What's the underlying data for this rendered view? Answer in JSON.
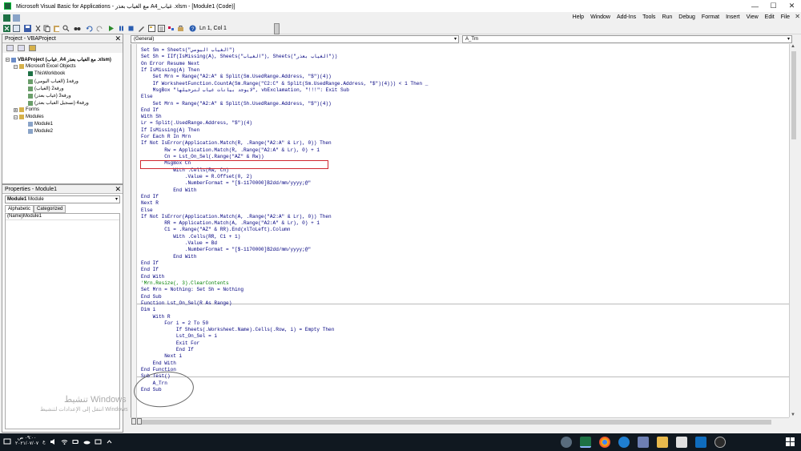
{
  "window": {
    "title": "Microsoft Visual Basic for Applications - مع الغياب بعذر A4_غياب .xlsm - [Module1 (Code)]",
    "controls": [
      "—",
      "☐",
      "✕"
    ]
  },
  "menu": {
    "items": [
      "Help",
      "Window",
      "Add-Ins",
      "Tools",
      "Run",
      "Debug",
      "Format",
      "Insert",
      "View",
      "Edit",
      "File"
    ],
    "close_glyph": "✕"
  },
  "toolbar": {
    "position_label": "Ln 1, Col 1"
  },
  "project_pane": {
    "title": "Project - VBAProject",
    "close_glyph": "✕",
    "tree": [
      {
        "label": "VBAProject (غياب_A4 مع الغياب بعذر .xlsm)",
        "level": 0,
        "bold": true,
        "expander": "−",
        "icon": "project-icon"
      },
      {
        "label": "Microsoft Excel Objects",
        "level": 1,
        "expander": "−",
        "icon": "folder-icon"
      },
      {
        "label": "ThisWorkbook",
        "level": 2,
        "icon": "workbook-icon"
      },
      {
        "label": "ورقة1 (الغياب اليومي)",
        "level": 2,
        "icon": "sheet-icon"
      },
      {
        "label": "ورقة2 (الغياب)",
        "level": 2,
        "icon": "sheet-icon"
      },
      {
        "label": "ورقة3 (غياب بعذر)",
        "level": 2,
        "icon": "sheet-icon"
      },
      {
        "label": "ورقة4 (تسجيل الغياب بعذر)",
        "level": 2,
        "icon": "sheet-icon"
      },
      {
        "label": "Forms",
        "level": 1,
        "expander": "+",
        "icon": "folder-icon"
      },
      {
        "label": "Modules",
        "level": 1,
        "expander": "−",
        "icon": "folder-icon"
      },
      {
        "label": "Module1",
        "level": 2,
        "icon": "module-icon"
      },
      {
        "label": "Module2",
        "level": 2,
        "icon": "module-icon"
      }
    ]
  },
  "properties_pane": {
    "title": "Properties - Module1",
    "close_glyph": "✕",
    "object_name": "Module1",
    "object_type": "Module",
    "tabs": [
      "Alphabetic",
      "Categorized"
    ],
    "rows": [
      {
        "name": "(Name)",
        "value": "Module1"
      }
    ]
  },
  "code_window": {
    "object_combo": "(General)",
    "proc_combo": "A_Trn",
    "lines": [
      {
        "t": "Set Sm = Sheets(\"الغياب اليومي\")",
        "s": "k"
      },
      {
        "t": "Set Sh = IIf(IsMissing(A), Sheets(\"الغياب\"), Sheets(\"الغياب بعذر\"))",
        "s": "k"
      },
      {
        "t": "On Error Resume Next",
        "s": "k"
      },
      {
        "t": "If IsMissing(A) Then",
        "s": "k"
      },
      {
        "t": "    Set Mrn = Range(\"A2:A\" & Split(Sm.UsedRange.Address, \"$\")(4))",
        "s": "k"
      },
      {
        "t": "    If WorksheetFunction.CountA(Sm.Range(\"C2:C\" & Split(Sm.UsedRange.Address, \"$\")(4))) < 1 Then _",
        "s": "k"
      },
      {
        "t": "    MsgBox \"لايوجد بيانات غياب لترحيلها\", vbExclamation, \"!!!\": Exit Sub",
        "s": "k"
      },
      {
        "t": "Else",
        "s": "k"
      },
      {
        "t": "    Set Mrn = Range(\"A2:A\" & Split(Sh.UsedRange.Address, \"$\")(4))",
        "s": "k"
      },
      {
        "t": "End If",
        "s": "k"
      },
      {
        "t": "With Sh",
        "s": "k"
      },
      {
        "t": "Lr = Split(.UsedRange.Address, \"$\")(4)",
        "s": "k"
      },
      {
        "t": "If IsMissing(A) Then",
        "s": "k"
      },
      {
        "t": "For Each R In Mrn",
        "s": "k"
      },
      {
        "t": "If Not IsError(Application.Match(R, .Range(\"A2:A\" & Lr), 0)) Then",
        "s": "k"
      },
      {
        "t": "        Rw = Application.Match(R, .Range(\"A2:A\" & Lr), 0) + 1",
        "s": "k"
      },
      {
        "t": "        Cn = Lst_On_Sel(.Range(\"AZ\" & Rw))",
        "s": "k"
      },
      {
        "t": "        MsgBox Cn",
        "s": "k"
      },
      {
        "t": "           With .Cells(Rw, Cn)",
        "s": "k"
      },
      {
        "t": "               .Value = R.Offset(0, 2)",
        "s": "k"
      },
      {
        "t": "               .NumberFormat = \"[$-1170000]B2dd/mm/yyyy;@\"",
        "s": "k"
      },
      {
        "t": "           End With",
        "s": "k"
      },
      {
        "t": "End If",
        "s": "k"
      },
      {
        "t": "Next R",
        "s": "k"
      },
      {
        "t": "Else",
        "s": "k"
      },
      {
        "t": "If Not IsError(Application.Match(A, .Range(\"A2:A\" & Lr), 0)) Then",
        "s": "k"
      },
      {
        "t": "        RR = Application.Match(A, .Range(\"A2:A\" & Lr), 0) + 1",
        "s": "k"
      },
      {
        "t": "        C1 = .Range(\"AZ\" & RR).End(xlToLeft).Column",
        "s": "k"
      },
      {
        "t": "           With .Cells(RR, C1 + 1)",
        "s": "k"
      },
      {
        "t": "               .Value = Bd",
        "s": "k"
      },
      {
        "t": "               .NumberFormat = \"[$-1170000]B2dd/mm/yyyy;@\"",
        "s": "k"
      },
      {
        "t": "           End With",
        "s": "k"
      },
      {
        "t": "End If",
        "s": "k"
      },
      {
        "t": "End If",
        "s": "k"
      },
      {
        "t": "End With",
        "s": "k"
      },
      {
        "t": "'Mrn.Resize(, 3).ClearContents",
        "s": "c"
      },
      {
        "t": "Set Mrn = Nothing: Set Sh = Nothing",
        "s": "k"
      },
      {
        "t": "End Sub",
        "s": "k"
      },
      {
        "t": "Function Lst_On_Sel(R As Range)",
        "s": "k"
      },
      {
        "t": "Dim i",
        "s": "k"
      },
      {
        "t": "    With R",
        "s": "k"
      },
      {
        "t": "        For i = 2 To 50",
        "s": "k"
      },
      {
        "t": "            If Sheets(.Worksheet.Name).Cells(.Row, i) = Empty Then",
        "s": "k"
      },
      {
        "t": "            Lst_On_Sel = i",
        "s": "k"
      },
      {
        "t": "            Exit For",
        "s": "k"
      },
      {
        "t": "            End If",
        "s": "k"
      },
      {
        "t": "        Next i",
        "s": "k"
      },
      {
        "t": "    End With",
        "s": "k"
      },
      {
        "t": "End Function",
        "s": "k"
      },
      {
        "t": "Sub Test()",
        "s": "k"
      },
      {
        "t": "    A_Trn",
        "s": "k"
      },
      {
        "t": "End Sub",
        "s": "k"
      }
    ]
  },
  "watermark": {
    "line1": "تنشيط Windows",
    "line2": "انتقل إلى الإعدادات لتنشيط Windows"
  },
  "taskbar": {
    "time": "٠٩:٠٠ ص",
    "date": "٢٠٢١/٠٧/٠٧",
    "lang": "ع",
    "icons": [
      "network-icon",
      "excel-icon",
      "chrome-icon",
      "edge-icon",
      "shield-icon",
      "explorer-icon",
      "store-icon",
      "mail-icon",
      "cortana-icon"
    ]
  }
}
